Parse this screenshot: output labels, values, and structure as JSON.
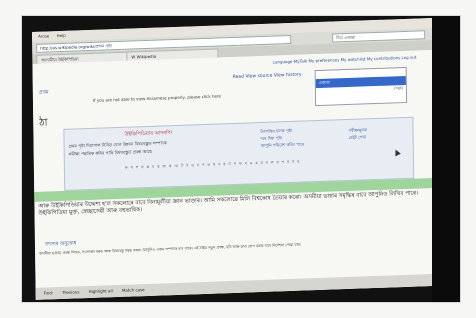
{
  "browser": {
    "menubar": [
      "Arose",
      "Help"
    ],
    "url": "http://as.wikipedia.org/wiki/প্ৰধান পৃষ্ঠা",
    "search_value": "দিয়া ওজাৱা",
    "tabs": [
      "আসামীয়া উইকিপিডিয়া",
      "W  Wikipedia"
    ],
    "find_label": "Find:",
    "find_options": [
      "Previous",
      "Highlight all",
      "Match case"
    ]
  },
  "page": {
    "toplinks": "Language  MyTalk  My preferences  My watchlist  My contributions  Log out",
    "read_row": "Read   View source   View history",
    "suggest_selected": "ওজাৱা",
    "suggest_other": "(সমূহ)",
    "notice": "If you are not able to view Assamese properly, please click here",
    "sidebar_link": "প্ৰথম",
    "heading": "ঠা",
    "infobox_title": "উইকিপিডিয়াৰ আদৰণি!",
    "infobox_lines": [
      "প্ৰথম পৃষ্ঠা দিয়াপাল নিবিড়  যোগ উন্নয়ন  বিষয়বস্তুত সম্পাদক",
      "সমীক্ষা পদ্ধতিক কৰিব পাৰি বিষয়বস্তুত প্ৰবন্ধ আছে"
    ],
    "infobox_col1": [
      "উৎপত্তিৰ ফলক পৃষ্ঠা",
      "দৰে দিয়া পৃষ্ঠা",
      "আপুনি পৰিৱেশ কৰিব পাৰে"
    ],
    "infobox_col2": [
      "পৰীক্ষামূলক",
      "ৱেইট পেজ"
    ],
    "infobox_glyphs": "ক খ গ ঘ ঙ চ ছ জ ঝ ঞ ট ঠ ড ঢ ণ ত থ দ ধ ন প ফ ব ভ ম য ৰ ল ৱ শ ষ স হ",
    "paragraph": "আৰু উইকিপিডিয়াৰ উদ্দেশ্য হ'ল সকলোৰে বাবে বিনামূলীয়া জ্ঞান ভাণ্ডাৰ। আমি সকলোৱে মিলি বিশ্বকোষ তৈয়াৰ কৰো। অসমীয়া ভাষাৰ সমৃদ্ধিৰ বাবে আপুনিও লিখিব পাৰে। উইকিপিডিয়া মুক্ত, স্বেচ্ছাসেৱী আৰু বহুভাষিক।",
    "subheading": "সদস্যৰ অনুৰোধ",
    "small_paragraph": "অসমীয়া ভাষাত প্ৰবন্ধ লিখক, সংশোধন কৰক আৰু বিষয়বস্তু সমৃদ্ধ কৰক। আপুনিও এজন সম্পাদক হ'ব পাৰে। এই ঠাইত নতুন প্ৰবন্ধ, ছবি আৰু তথ্য যোগ কৰাৰ বাবে নিৰ্দেশনা পোৱা যায়।"
  }
}
